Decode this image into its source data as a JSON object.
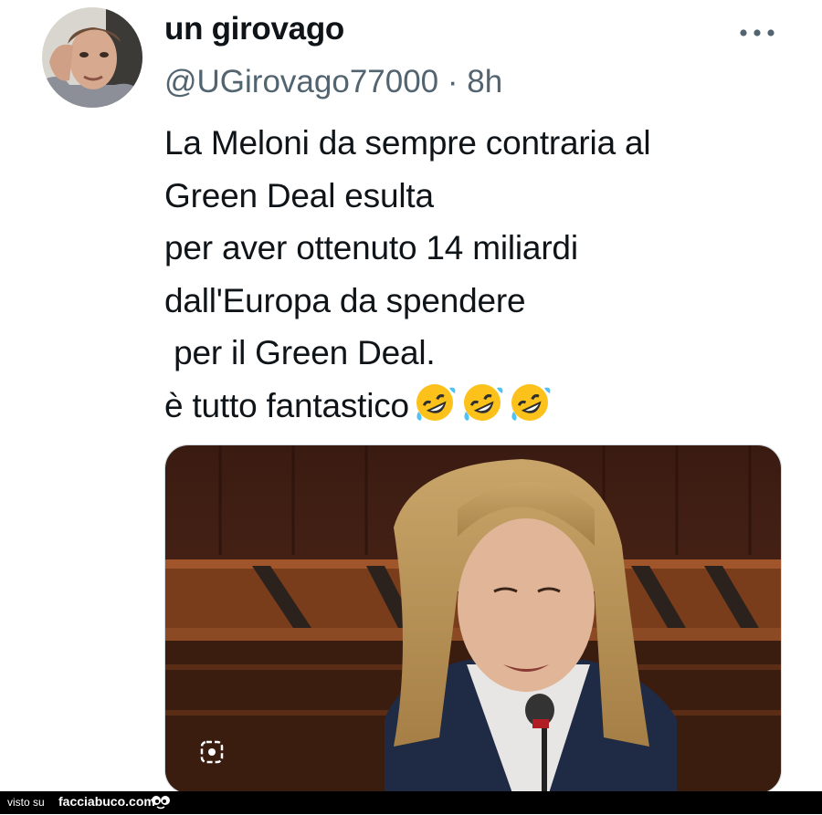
{
  "tweet": {
    "display_name": "un girovago",
    "handle": "@UGirovago77000",
    "separator": " · ",
    "time": "8h",
    "text": "La Meloni da sempre contraria al\nGreen Deal esulta\nper aver ottenuto 14 miliardi\ndall'Europa da spendere\n per il Green Deal.\nè tutto fantastico",
    "emoji": [
      "rolling-on-floor-laughing",
      "rolling-on-floor-laughing",
      "rolling-on-floor-laughing"
    ],
    "more_icon": "more-horizontal-icon",
    "media_icon": "alt-text-icon"
  },
  "footer": {
    "visto_label": "visto su",
    "site_label": "facciabuco.com"
  },
  "colors": {
    "text": "#0f1419",
    "secondary": "#536471",
    "border": "#cfd9de",
    "footer_bg": "#000000"
  }
}
